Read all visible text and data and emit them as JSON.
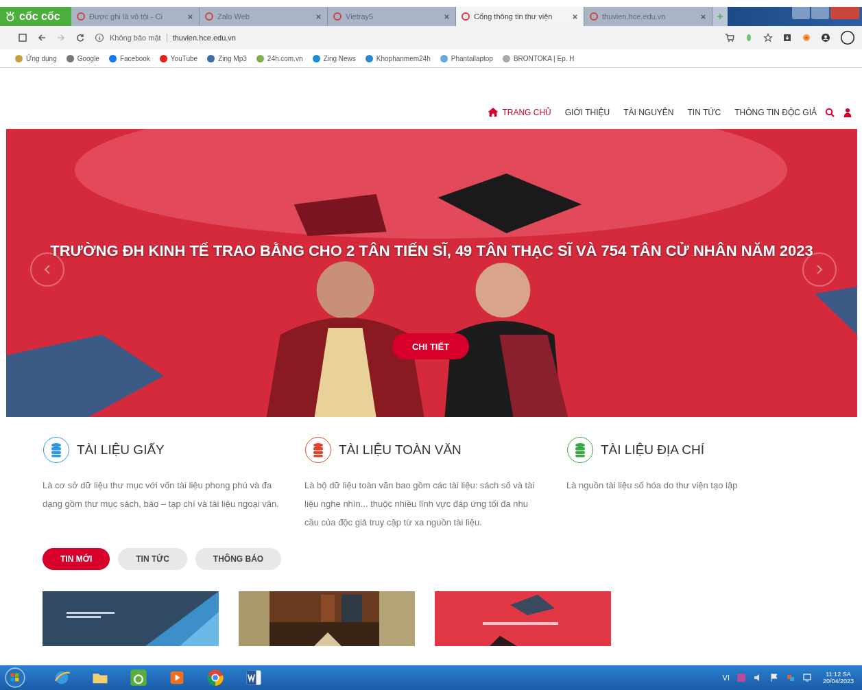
{
  "browser": {
    "brand": "cốc cốc",
    "tabs": [
      {
        "title": "Được ghi là vô tội - Ci",
        "selected": false
      },
      {
        "title": "Zalo Web",
        "selected": false
      },
      {
        "title": "Vietray5",
        "selected": false
      },
      {
        "title": "Cổng thông tin thư viện",
        "selected": true
      },
      {
        "title": "thuvien.hce.edu.vn",
        "selected": false
      }
    ],
    "address": {
      "security": "Không bảo mật",
      "url": "thuvien.hce.edu.vn"
    },
    "bookmarks": [
      {
        "label": "Ứng dụng",
        "color": "#c9a040"
      },
      {
        "label": "Google",
        "color": "#777777"
      },
      {
        "label": "Facebook",
        "color": "#1877f2"
      },
      {
        "label": "YouTube",
        "color": "#e62117"
      },
      {
        "label": "Zing Mp3",
        "color": "#3a6ea5"
      },
      {
        "label": "24h.com.vn",
        "color": "#7fb04a"
      },
      {
        "label": "Zing News",
        "color": "#1a8fd8"
      },
      {
        "label": "Khophanmem24h",
        "color": "#2a8ad4"
      },
      {
        "label": "Phantailaptop",
        "color": "#6aa8e0"
      },
      {
        "label": "BRONTOKA | Ep. H",
        "color": "#aaaaaa"
      }
    ]
  },
  "site": {
    "nav": [
      {
        "label": "TRANG CHỦ",
        "selected": true
      },
      {
        "label": "GIỚI THIỆU",
        "selected": false
      },
      {
        "label": "TÀI NGUYÊN",
        "selected": false
      },
      {
        "label": "TIN TỨC",
        "selected": false
      },
      {
        "label": "THÔNG TIN ĐỘC GIẢ",
        "selected": false
      }
    ],
    "hero": {
      "headline": "TRƯỜNG ĐH KINH TẾ TRAO BẰNG CHO 2 TÂN TIẾN SĨ, 49 TÂN THẠC SĨ VÀ 754 TÂN CỬ NHÂN NĂM 2023",
      "button": "CHI TIẾT"
    },
    "features": [
      {
        "title": "TÀI LIỆU GIẤY",
        "description": "Là cơ sở dữ liệu thư mục với vốn tài liệu phong phú và đa dạng gồm thư mục sách, báo – tạp chí và tài liệu ngoại văn.",
        "color": "#2a9be0"
      },
      {
        "title": "TÀI LIỆU TOÀN VĂN",
        "description": "Là bộ dữ liệu toàn văn bao gồm các tài liệu: sách số và tài liệu nghe nhìn... thuộc nhiều lĩnh vực đáp ứng tối đa nhu cầu của độc giả truy cập từ xa nguồn tài liệu.",
        "color": "#e0452a"
      },
      {
        "title": "TÀI LIỆU ĐỊA CHÍ",
        "description": "Là nguồn tài liệu số hóa do thư viện tạo lập",
        "color": "#3aa845"
      }
    ],
    "news_tabs": [
      {
        "label": "TIN MỚI",
        "selected": true
      },
      {
        "label": "TIN TỨC",
        "selected": false
      },
      {
        "label": "THÔNG BÁO",
        "selected": false
      }
    ],
    "news_cards": [
      {
        "kind": "slide"
      },
      {
        "kind": "books"
      },
      {
        "kind": "ceremony"
      }
    ]
  },
  "taskbar": {
    "language": "VI",
    "time": "11:12 SA",
    "date": "20/04/2023"
  }
}
